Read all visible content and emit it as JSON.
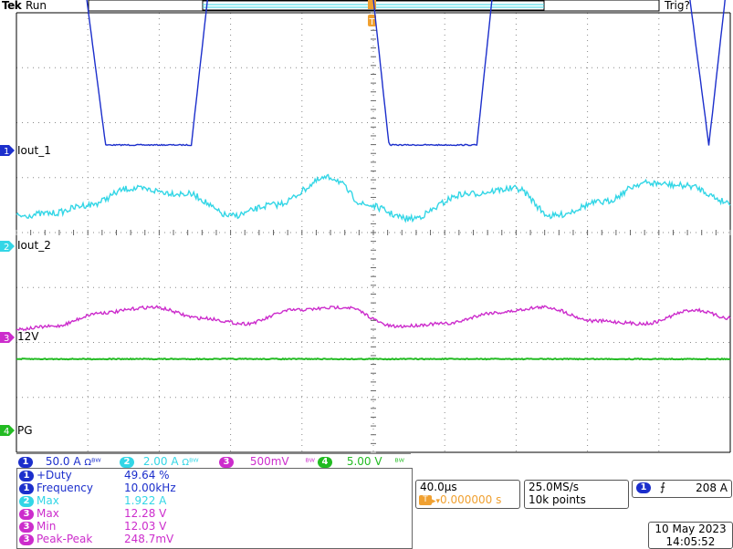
{
  "header": {
    "brand": "Tek",
    "status": "Run",
    "trigger_status": "Trig?"
  },
  "colors": {
    "ch1": "#1c2fcc",
    "ch2": "#33d6e6",
    "ch3": "#cc2ccc",
    "ch4": "#22bb22",
    "trigger": "#f0a030",
    "grid": "#888888"
  },
  "chart_data": {
    "type": "line",
    "title": "",
    "xlabel": "",
    "ylabel": "",
    "x_unit_per_div": "40.0µs",
    "divisions": {
      "x": 10,
      "y": 8
    },
    "series": [
      {
        "name": "Iout_1",
        "channel": 1,
        "description": "square wave ~10 kHz, 49.64% duty",
        "x_div": [
          0,
          0.9,
          1.25,
          2.45,
          2.75,
          4.93,
          5.22,
          6.45,
          6.73,
          9.35,
          9.7,
          10
        ],
        "y_div": [
          3.6,
          3.6,
          0.1,
          0.1,
          3.6,
          3.6,
          0.1,
          0.1,
          3.6,
          3.6,
          0.1,
          3.6
        ]
      },
      {
        "name": "Iout_2",
        "channel": 2,
        "description": "noisy ripple around baseline",
        "x_div": [
          0,
          0.5,
          1.0,
          1.6,
          2.4,
          3.0,
          3.6,
          4.4,
          4.9,
          5.5,
          6.3,
          7.0,
          7.5,
          8.2,
          8.8,
          9.4,
          10
        ],
        "y_div": [
          0.55,
          0.6,
          0.75,
          1.05,
          0.95,
          0.55,
          0.75,
          1.25,
          0.75,
          0.5,
          0.95,
          1.05,
          0.55,
          0.8,
          1.15,
          1.1,
          0.8
        ]
      },
      {
        "name": "12V",
        "channel": 3,
        "description": "sinusoidal ripple, 248.7 mV pk-pk",
        "x_div": [
          0,
          0.5,
          1.2,
          1.9,
          2.6,
          3.2,
          3.9,
          4.6,
          5.3,
          6.0,
          6.7,
          7.4,
          8.1,
          8.8,
          9.5,
          10
        ],
        "y_div": [
          0.15,
          0.2,
          0.45,
          0.55,
          0.35,
          0.25,
          0.5,
          0.55,
          0.2,
          0.25,
          0.45,
          0.55,
          0.3,
          0.25,
          0.5,
          0.35
        ]
      },
      {
        "name": "PG",
        "channel": 4,
        "description": "flat logic high",
        "x_div": [
          0,
          10
        ],
        "y_div": [
          1.3,
          1.3
        ]
      }
    ]
  },
  "channels": [
    {
      "num": "1",
      "label": "Iout_1",
      "scale": "50.0 A",
      "coupling_icon": "Ω",
      "bw_icon": "ᴮᵂ"
    },
    {
      "num": "2",
      "label": "Iout_2",
      "scale": "2.00 A",
      "coupling_icon": "Ω",
      "bw_icon": "ᴮᵂ"
    },
    {
      "num": "3",
      "label": "12V",
      "scale": "500mV",
      "bw_icon": "ᴮᵂ"
    },
    {
      "num": "4",
      "label": "PG",
      "scale": "5.00 V",
      "bw_icon": "ᴮᵂ"
    }
  ],
  "measurements": [
    {
      "ch": "1",
      "label": "+Duty",
      "value": "49.64 %"
    },
    {
      "ch": "1",
      "label": "Frequency",
      "value": "10.00kHz"
    },
    {
      "ch": "2",
      "label": "Max",
      "value": "1.922 A"
    },
    {
      "ch": "3",
      "label": "Max",
      "value": "12.28 V"
    },
    {
      "ch": "3",
      "label": "Min",
      "value": "12.03 V"
    },
    {
      "ch": "3",
      "label": "Peak-Peak",
      "value": "248.7mV"
    }
  ],
  "timebase": {
    "scale": "40.0µs",
    "trigger_icon": "T",
    "position": "0.000000 s",
    "arrow": "▸▾"
  },
  "acquisition": {
    "rate": "25.0MS/s",
    "record": "10k points"
  },
  "trigger": {
    "channel": "1",
    "slope_icon": "⨍",
    "level": "208 A"
  },
  "datetime": {
    "date": "10 May 2023",
    "time": "14:05:52"
  }
}
